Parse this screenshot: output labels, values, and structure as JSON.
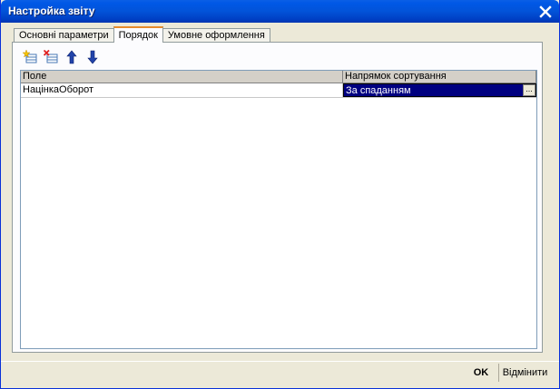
{
  "window": {
    "title": "Настройка звіту"
  },
  "tabs": [
    {
      "label": "Основні параметри",
      "active": false
    },
    {
      "label": "Порядок",
      "active": true
    },
    {
      "label": "Умовне оформлення",
      "active": false
    }
  ],
  "toolbar": {
    "icons": [
      "add-row-icon",
      "delete-row-icon",
      "move-up-icon",
      "move-down-icon"
    ]
  },
  "grid": {
    "headers": [
      "Поле",
      "Напрямок сортування"
    ],
    "rows": [
      {
        "field": "НацінкаОборот",
        "direction": "За спаданням"
      }
    ]
  },
  "buttons": {
    "ok": "OK",
    "cancel": "Відмінити",
    "ellipsis": "..."
  },
  "colors": {
    "titlebar": "#0054e3",
    "selection": "#000080",
    "panel": "#ece9d8"
  }
}
